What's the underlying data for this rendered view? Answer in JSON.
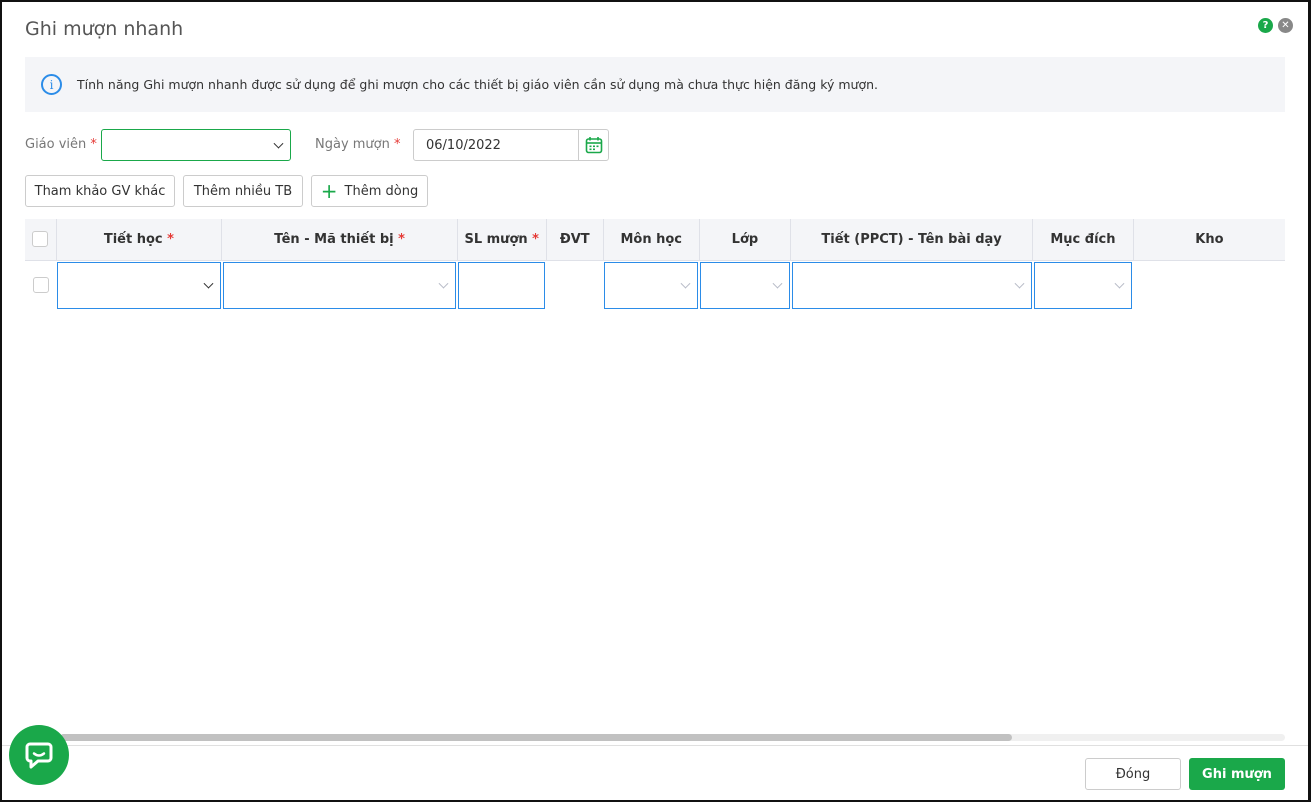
{
  "dialog": {
    "title": "Ghi mượn nhanh"
  },
  "info": {
    "text": "Tính năng Ghi mượn nhanh được sử dụng để ghi mượn cho các thiết bị giáo viên cần sử dụng mà chưa thực hiện đăng ký mượn."
  },
  "form": {
    "teacher_label": "Giáo viên",
    "teacher_value": "",
    "date_label": "Ngày mượn",
    "date_value": "06/10/2022",
    "required_mark": "*"
  },
  "toolbar": {
    "ref_label": "Tham khảo GV khác",
    "add_many_label": "Thêm nhiều TB",
    "add_row_label": "Thêm dòng"
  },
  "table": {
    "columns": [
      "Tiết học",
      "Tên - Mã thiết bị",
      "SL mượn",
      "ĐVT",
      "Môn học",
      "Lớp",
      "Tiết (PPCT) - Tên bài dạy",
      "Mục đích",
      "Kho"
    ],
    "required": [
      true,
      true,
      true,
      false,
      false,
      false,
      false,
      false,
      false
    ]
  },
  "footer": {
    "close_label": "Đóng",
    "submit_label": "Ghi mượn"
  },
  "colors": {
    "accent": "#1aa84a",
    "focus": "#2b8ce8",
    "required": "#e53935"
  }
}
